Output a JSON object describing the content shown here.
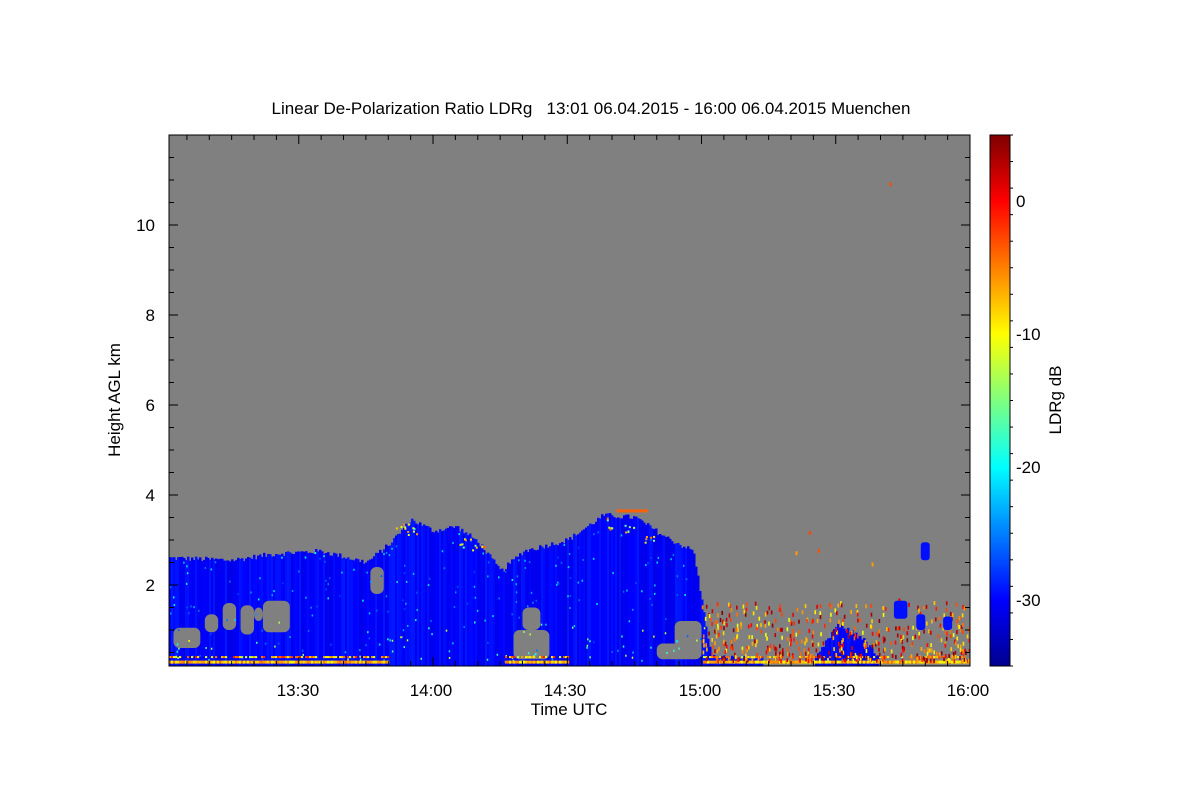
{
  "chart_data": {
    "type": "heatmap",
    "title": "Linear De-Polarization Ratio LDRg   13:01 06.04.2015 - 16:00 06.04.2015 Muenchen",
    "xlabel": "Time UTC",
    "ylabel": "Height AGL km",
    "xlim": [
      "13:01",
      "16:00"
    ],
    "ylim": [
      0.2,
      12
    ],
    "x_ticks": [
      "13:30",
      "14:00",
      "14:30",
      "15:00",
      "15:30",
      "16:00"
    ],
    "y_ticks": [
      "2",
      "4",
      "6",
      "8",
      "10"
    ],
    "colorbar": {
      "label": "LDRg dB",
      "range": [
        -35,
        5
      ],
      "ticks": [
        "0",
        "-10",
        "-20",
        "-30"
      ],
      "colormap": "jet"
    },
    "background_color": "#808080",
    "cloud_top_km": [
      {
        "t": "13:01",
        "h": 2.6
      },
      {
        "t": "13:15",
        "h": 2.55
      },
      {
        "t": "13:25",
        "h": 2.7
      },
      {
        "t": "13:35",
        "h": 2.75
      },
      {
        "t": "13:45",
        "h": 2.5
      },
      {
        "t": "13:50",
        "h": 2.9
      },
      {
        "t": "13:55",
        "h": 3.45
      },
      {
        "t": "14:00",
        "h": 3.2
      },
      {
        "t": "14:05",
        "h": 3.3
      },
      {
        "t": "14:10",
        "h": 2.95
      },
      {
        "t": "14:15",
        "h": 2.3
      },
      {
        "t": "14:20",
        "h": 2.75
      },
      {
        "t": "14:30",
        "h": 3.0
      },
      {
        "t": "14:38",
        "h": 3.55
      },
      {
        "t": "14:45",
        "h": 3.5
      },
      {
        "t": "14:52",
        "h": 3.05
      },
      {
        "t": "14:58",
        "h": 2.75
      },
      {
        "t": "15:02",
        "h": 0.4
      },
      {
        "t": "15:25",
        "h": 0.3
      },
      {
        "t": "15:30",
        "h": 1.1
      },
      {
        "t": "15:35",
        "h": 0.9
      },
      {
        "t": "15:40",
        "h": 0.3
      }
    ]
  },
  "colors": {
    "no_data": "#808080",
    "cloud": "#1430ff",
    "surface_layer": "#f0e020"
  }
}
